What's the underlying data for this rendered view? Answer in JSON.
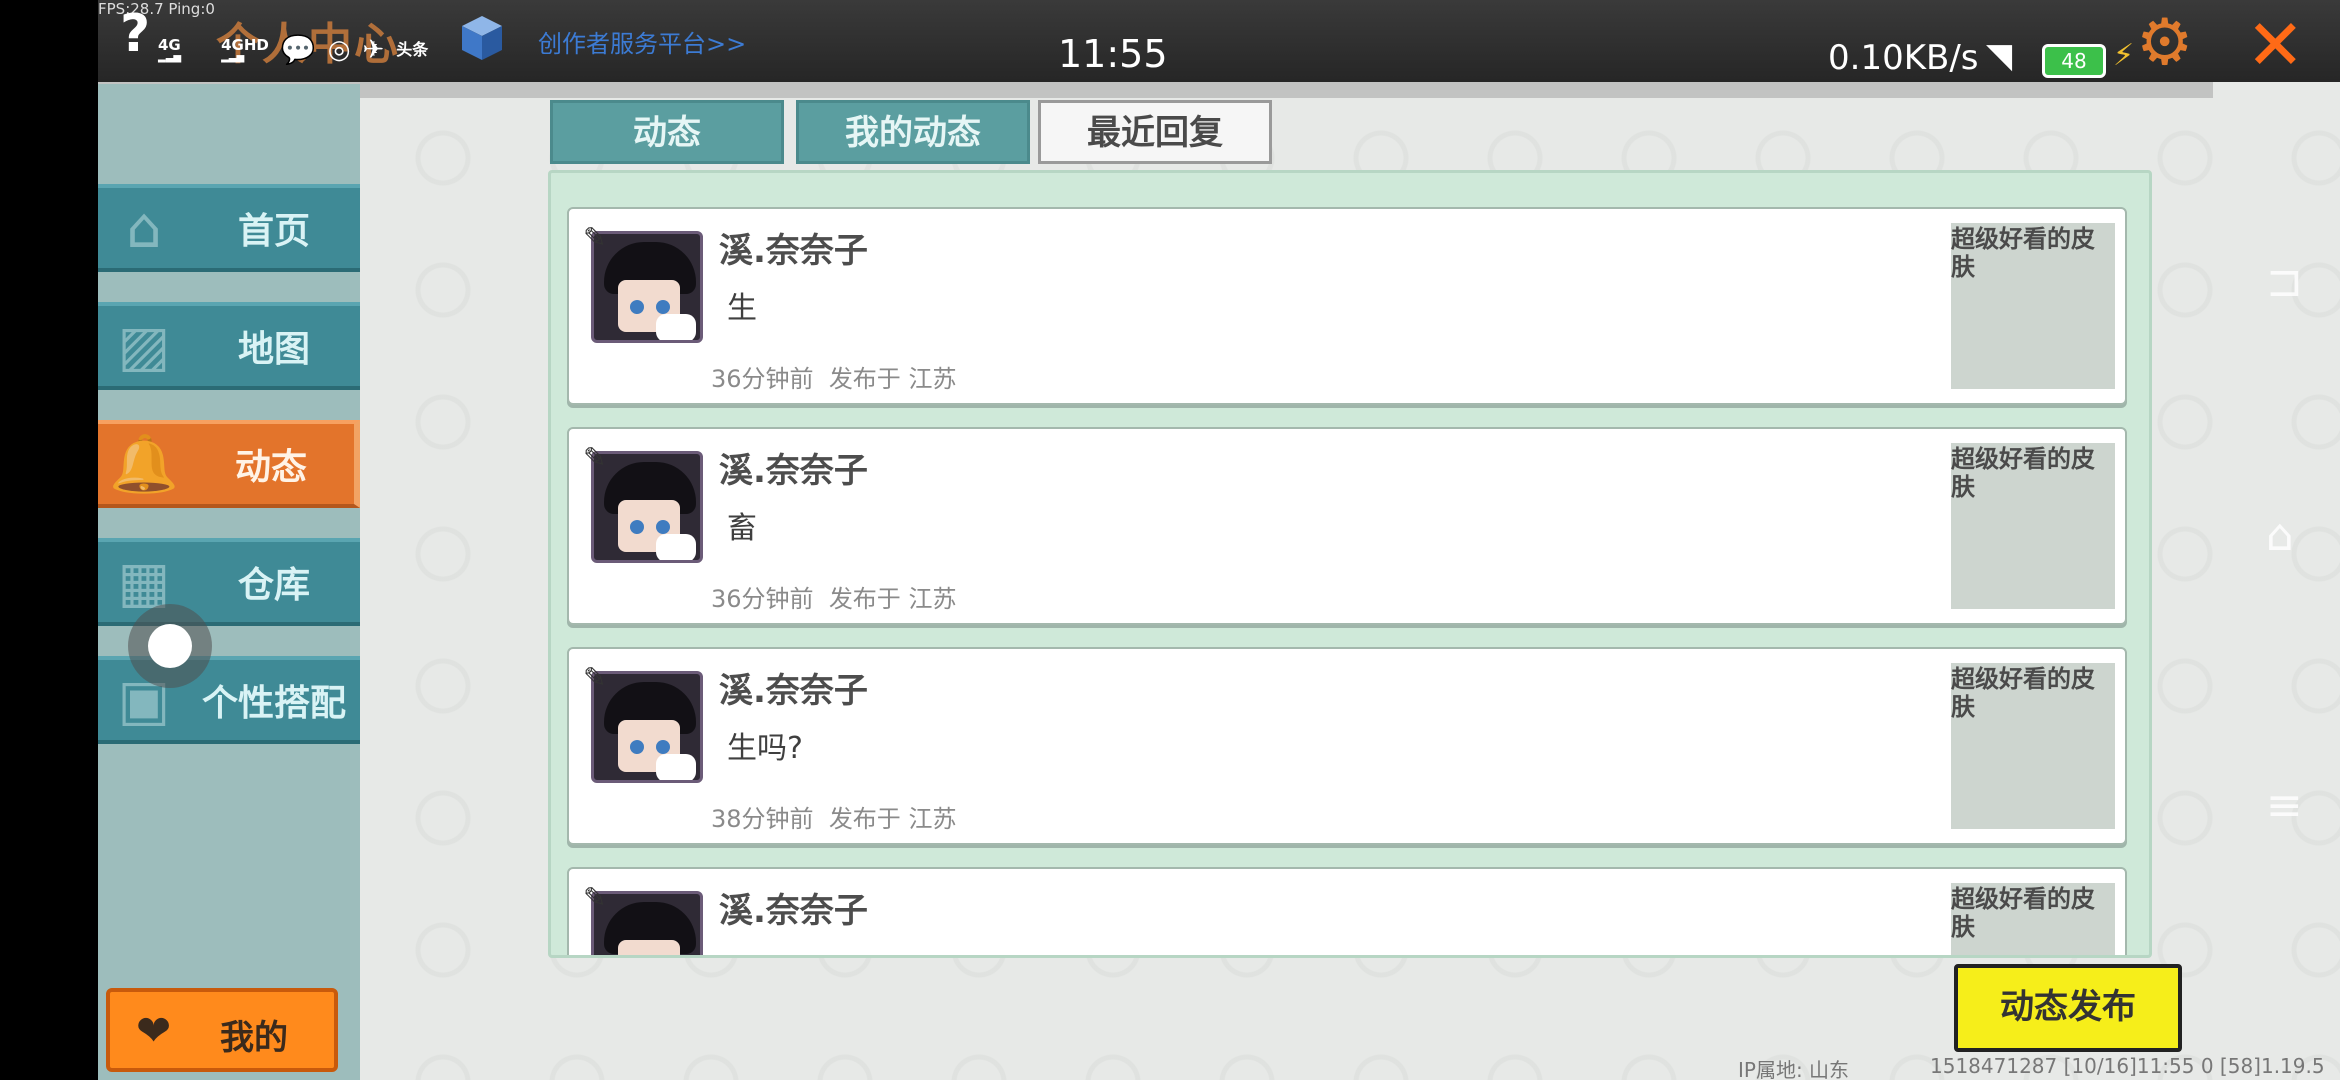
{
  "status_bar": {
    "fps_text": "FPS:28.7  Ping:0",
    "game_title": "个人中心",
    "creator_link": "创作者服务平台>>",
    "time": "11:55",
    "net_speed": "0.10KB/s",
    "battery": "48",
    "sig1": "4G",
    "sig2": "4GHD",
    "toutiao": "头条"
  },
  "sidebar": {
    "items": [
      {
        "label": "首页",
        "icon": "home-icon"
      },
      {
        "label": "地图",
        "icon": "map-icon"
      },
      {
        "label": "动态",
        "icon": "bell-icon"
      },
      {
        "label": "仓库",
        "icon": "warehouse-icon"
      },
      {
        "label": "个性搭配",
        "icon": "outfit-icon"
      }
    ],
    "active_index": 2,
    "my_button": "我的"
  },
  "tabs": [
    {
      "label": "动态",
      "active": false
    },
    {
      "label": "我的动态",
      "active": false
    },
    {
      "label": "最近回复",
      "active": true
    }
  ],
  "feed": [
    {
      "user": "溪.奈奈子",
      "text": "生",
      "time": "36分钟前",
      "location": "发布于 江苏",
      "skin": "超级好看的皮肤"
    },
    {
      "user": "溪.奈奈子",
      "text": "畜",
      "time": "36分钟前",
      "location": "发布于 江苏",
      "skin": "超级好看的皮肤"
    },
    {
      "user": "溪.奈奈子",
      "text": "生吗?",
      "time": "38分钟前",
      "location": "发布于 江苏",
      "skin": "超级好看的皮肤"
    },
    {
      "user": "溪.奈奈子",
      "text": "",
      "time": "",
      "location": "",
      "skin": "超级好看的皮肤"
    }
  ],
  "publish_button": "动态发布",
  "footer": {
    "ip": "IP属地: 山东",
    "info": "1518471287    [10/16]11:55 0   [58]1.19.5"
  },
  "colors": {
    "accent_orange": "#e3742b",
    "tab_teal": "#5b9ea0",
    "panel_green": "#cfe9d9",
    "publish_yellow": "#f6ee1a"
  }
}
